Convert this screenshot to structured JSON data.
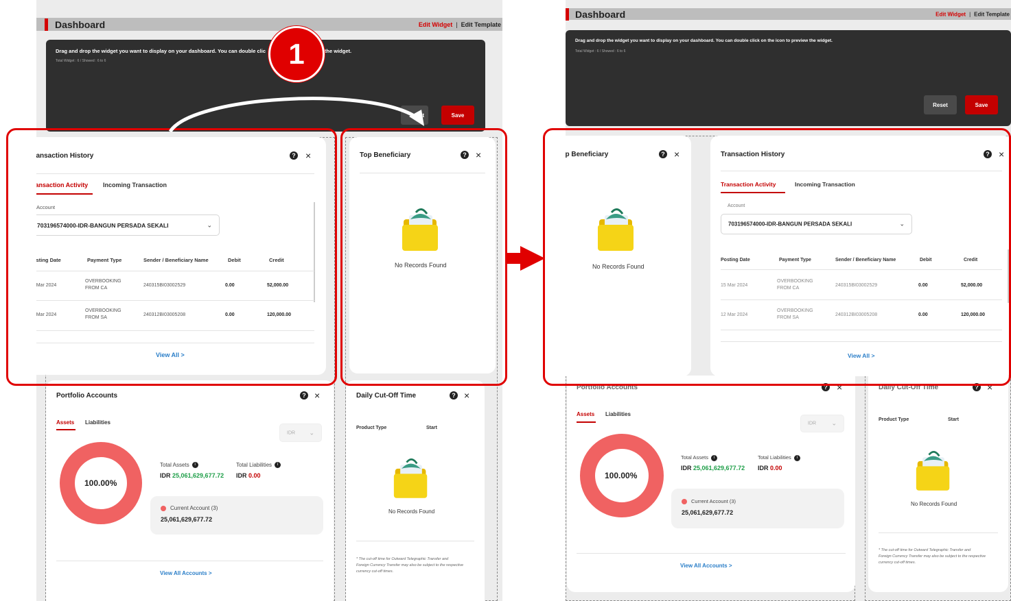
{
  "header": {
    "title": "Dashboard",
    "edit_widget": "Edit Widget",
    "separator": "|",
    "edit_template": "Edit Template"
  },
  "instructions": {
    "left": "Drag and drop the widget you want to display on your dashboard. You can double clic",
    "left_tail": "w the widget.",
    "right": "Drag and drop the widget you want to display on your dashboard. You can double click on the icon to preview the widget.",
    "count": "Total Widget : 6 / Showed : 6 to 6"
  },
  "buttons": {
    "reset": "Reset",
    "reset_partial": "et",
    "save": "Save"
  },
  "step_badge": "1",
  "transaction_history": {
    "title": "Transaction History",
    "tabs": [
      "Transaction Activity",
      "Incoming Transaction"
    ],
    "account_label": "Account",
    "account_value": "703196574000-IDR-BANGUN PERSADA SEKALI",
    "columns": [
      "Posting Date",
      "Payment Type",
      "Sender / Beneficiary Name",
      "Debit",
      "Credit"
    ],
    "rows": [
      {
        "date": "15 Mar 2024",
        "type1": "OVERBOOKING",
        "type2": "FROM CA",
        "name": "240315BI03002529",
        "debit": "0.00",
        "credit": "52,000.00"
      },
      {
        "date": "12 Mar 2024",
        "type1": "OVERBOOKING",
        "type2": "FROM SA",
        "name": "240312BI03005208",
        "debit": "0.00",
        "credit": "120,000.00"
      }
    ],
    "view_all": "View All >"
  },
  "top_beneficiary": {
    "title": "Top Beneficiary",
    "no_records": "No Records Found"
  },
  "portfolio": {
    "title": "Portfolio Accounts",
    "tabs": [
      "Assets",
      "Liabilities"
    ],
    "currency": "IDR",
    "donut_label": "100.00%",
    "total_assets_label": "Total Assets",
    "total_assets_prefix": "IDR",
    "total_assets_value": "25,061,629,677.72",
    "total_liabilities_label": "Total Liabilities",
    "total_liabilities_prefix": "IDR",
    "total_liabilities_value": "0.00",
    "current_account_label": "Current Account (3)",
    "current_account_value": "25,061,629,677.72",
    "view_all": "View All Accounts >",
    "accent": "#f06262"
  },
  "cutoff": {
    "title": "Daily Cut-Off Time",
    "col_product": "Product Type",
    "col_start": "Start",
    "no_records": "No Records Found",
    "note_l1": "* The cut-off time for Outward Telegraphic Transfer and",
    "note_l2": "Foreign Currency Transfer may also be subject to the respective",
    "note_l3": "currency cut-off times."
  },
  "icons": {
    "help": "?",
    "close": "×",
    "chevron": "⌄"
  },
  "colors": {
    "brand_red": "#d40000",
    "highlight_red": "#e00000",
    "dark_panel": "#2f2f2f",
    "link_blue": "#2a7ec8",
    "green": "#1e9e48"
  }
}
